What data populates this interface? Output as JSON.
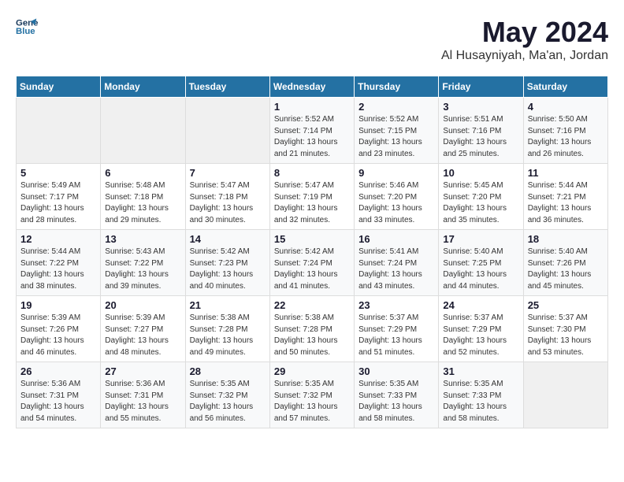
{
  "header": {
    "logo_line1": "General",
    "logo_line2": "Blue",
    "title": "May 2024",
    "subtitle": "Al Husayniyah, Ma'an, Jordan"
  },
  "weekdays": [
    "Sunday",
    "Monday",
    "Tuesday",
    "Wednesday",
    "Thursday",
    "Friday",
    "Saturday"
  ],
  "weeks": [
    [
      {
        "day": "",
        "sunrise": "",
        "sunset": "",
        "daylight": ""
      },
      {
        "day": "",
        "sunrise": "",
        "sunset": "",
        "daylight": ""
      },
      {
        "day": "",
        "sunrise": "",
        "sunset": "",
        "daylight": ""
      },
      {
        "day": "1",
        "sunrise": "Sunrise: 5:52 AM",
        "sunset": "Sunset: 7:14 PM",
        "daylight": "Daylight: 13 hours and 21 minutes."
      },
      {
        "day": "2",
        "sunrise": "Sunrise: 5:52 AM",
        "sunset": "Sunset: 7:15 PM",
        "daylight": "Daylight: 13 hours and 23 minutes."
      },
      {
        "day": "3",
        "sunrise": "Sunrise: 5:51 AM",
        "sunset": "Sunset: 7:16 PM",
        "daylight": "Daylight: 13 hours and 25 minutes."
      },
      {
        "day": "4",
        "sunrise": "Sunrise: 5:50 AM",
        "sunset": "Sunset: 7:16 PM",
        "daylight": "Daylight: 13 hours and 26 minutes."
      }
    ],
    [
      {
        "day": "5",
        "sunrise": "Sunrise: 5:49 AM",
        "sunset": "Sunset: 7:17 PM",
        "daylight": "Daylight: 13 hours and 28 minutes."
      },
      {
        "day": "6",
        "sunrise": "Sunrise: 5:48 AM",
        "sunset": "Sunset: 7:18 PM",
        "daylight": "Daylight: 13 hours and 29 minutes."
      },
      {
        "day": "7",
        "sunrise": "Sunrise: 5:47 AM",
        "sunset": "Sunset: 7:18 PM",
        "daylight": "Daylight: 13 hours and 30 minutes."
      },
      {
        "day": "8",
        "sunrise": "Sunrise: 5:47 AM",
        "sunset": "Sunset: 7:19 PM",
        "daylight": "Daylight: 13 hours and 32 minutes."
      },
      {
        "day": "9",
        "sunrise": "Sunrise: 5:46 AM",
        "sunset": "Sunset: 7:20 PM",
        "daylight": "Daylight: 13 hours and 33 minutes."
      },
      {
        "day": "10",
        "sunrise": "Sunrise: 5:45 AM",
        "sunset": "Sunset: 7:20 PM",
        "daylight": "Daylight: 13 hours and 35 minutes."
      },
      {
        "day": "11",
        "sunrise": "Sunrise: 5:44 AM",
        "sunset": "Sunset: 7:21 PM",
        "daylight": "Daylight: 13 hours and 36 minutes."
      }
    ],
    [
      {
        "day": "12",
        "sunrise": "Sunrise: 5:44 AM",
        "sunset": "Sunset: 7:22 PM",
        "daylight": "Daylight: 13 hours and 38 minutes."
      },
      {
        "day": "13",
        "sunrise": "Sunrise: 5:43 AM",
        "sunset": "Sunset: 7:22 PM",
        "daylight": "Daylight: 13 hours and 39 minutes."
      },
      {
        "day": "14",
        "sunrise": "Sunrise: 5:42 AM",
        "sunset": "Sunset: 7:23 PM",
        "daylight": "Daylight: 13 hours and 40 minutes."
      },
      {
        "day": "15",
        "sunrise": "Sunrise: 5:42 AM",
        "sunset": "Sunset: 7:24 PM",
        "daylight": "Daylight: 13 hours and 41 minutes."
      },
      {
        "day": "16",
        "sunrise": "Sunrise: 5:41 AM",
        "sunset": "Sunset: 7:24 PM",
        "daylight": "Daylight: 13 hours and 43 minutes."
      },
      {
        "day": "17",
        "sunrise": "Sunrise: 5:40 AM",
        "sunset": "Sunset: 7:25 PM",
        "daylight": "Daylight: 13 hours and 44 minutes."
      },
      {
        "day": "18",
        "sunrise": "Sunrise: 5:40 AM",
        "sunset": "Sunset: 7:26 PM",
        "daylight": "Daylight: 13 hours and 45 minutes."
      }
    ],
    [
      {
        "day": "19",
        "sunrise": "Sunrise: 5:39 AM",
        "sunset": "Sunset: 7:26 PM",
        "daylight": "Daylight: 13 hours and 46 minutes."
      },
      {
        "day": "20",
        "sunrise": "Sunrise: 5:39 AM",
        "sunset": "Sunset: 7:27 PM",
        "daylight": "Daylight: 13 hours and 48 minutes."
      },
      {
        "day": "21",
        "sunrise": "Sunrise: 5:38 AM",
        "sunset": "Sunset: 7:28 PM",
        "daylight": "Daylight: 13 hours and 49 minutes."
      },
      {
        "day": "22",
        "sunrise": "Sunrise: 5:38 AM",
        "sunset": "Sunset: 7:28 PM",
        "daylight": "Daylight: 13 hours and 50 minutes."
      },
      {
        "day": "23",
        "sunrise": "Sunrise: 5:37 AM",
        "sunset": "Sunset: 7:29 PM",
        "daylight": "Daylight: 13 hours and 51 minutes."
      },
      {
        "day": "24",
        "sunrise": "Sunrise: 5:37 AM",
        "sunset": "Sunset: 7:29 PM",
        "daylight": "Daylight: 13 hours and 52 minutes."
      },
      {
        "day": "25",
        "sunrise": "Sunrise: 5:37 AM",
        "sunset": "Sunset: 7:30 PM",
        "daylight": "Daylight: 13 hours and 53 minutes."
      }
    ],
    [
      {
        "day": "26",
        "sunrise": "Sunrise: 5:36 AM",
        "sunset": "Sunset: 7:31 PM",
        "daylight": "Daylight: 13 hours and 54 minutes."
      },
      {
        "day": "27",
        "sunrise": "Sunrise: 5:36 AM",
        "sunset": "Sunset: 7:31 PM",
        "daylight": "Daylight: 13 hours and 55 minutes."
      },
      {
        "day": "28",
        "sunrise": "Sunrise: 5:35 AM",
        "sunset": "Sunset: 7:32 PM",
        "daylight": "Daylight: 13 hours and 56 minutes."
      },
      {
        "day": "29",
        "sunrise": "Sunrise: 5:35 AM",
        "sunset": "Sunset: 7:32 PM",
        "daylight": "Daylight: 13 hours and 57 minutes."
      },
      {
        "day": "30",
        "sunrise": "Sunrise: 5:35 AM",
        "sunset": "Sunset: 7:33 PM",
        "daylight": "Daylight: 13 hours and 58 minutes."
      },
      {
        "day": "31",
        "sunrise": "Sunrise: 5:35 AM",
        "sunset": "Sunset: 7:33 PM",
        "daylight": "Daylight: 13 hours and 58 minutes."
      },
      {
        "day": "",
        "sunrise": "",
        "sunset": "",
        "daylight": ""
      }
    ]
  ]
}
